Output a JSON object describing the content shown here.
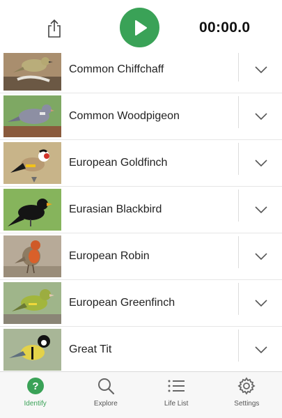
{
  "header": {
    "share_icon": "share-icon",
    "play_icon": "play-icon",
    "timer": "00:00.0",
    "accent_color": "#3aa257"
  },
  "birds": [
    {
      "name": "Common Chiffchaff"
    },
    {
      "name": "Common Woodpigeon"
    },
    {
      "name": "European Goldfinch"
    },
    {
      "name": "Eurasian Blackbird"
    },
    {
      "name": "European Robin"
    },
    {
      "name": "European Greenfinch"
    },
    {
      "name": "Great Tit"
    }
  ],
  "tabs": [
    {
      "label": "Identify",
      "icon": "question-icon",
      "active": true
    },
    {
      "label": "Explore",
      "icon": "search-icon",
      "active": false
    },
    {
      "label": "Life List",
      "icon": "list-icon",
      "active": false
    },
    {
      "label": "Settings",
      "icon": "gear-icon",
      "active": false
    }
  ]
}
